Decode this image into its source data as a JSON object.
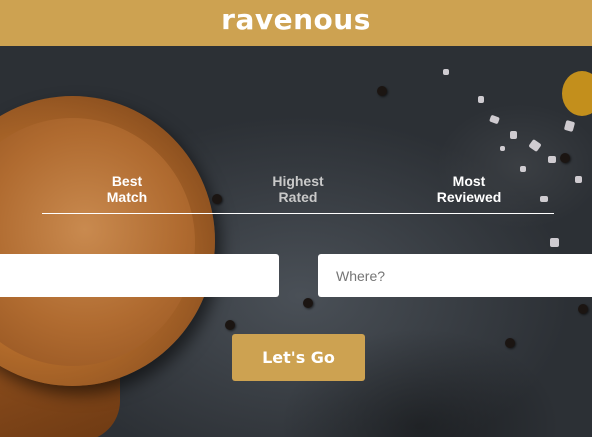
{
  "header": {
    "brand": "ravenous"
  },
  "sort_options": [
    {
      "line1": "Best",
      "line2": "Match",
      "active": true
    },
    {
      "line1": "Highest",
      "line2": "Rated",
      "active": false
    },
    {
      "line1": "Most",
      "line2": "Reviewed",
      "active": true
    }
  ],
  "search": {
    "term_value": "",
    "term_placeholder": "",
    "location_placeholder": "Where?"
  },
  "submit": {
    "label": "Let's Go"
  },
  "colors": {
    "brand": "#cda251",
    "text": "#ffffff"
  }
}
